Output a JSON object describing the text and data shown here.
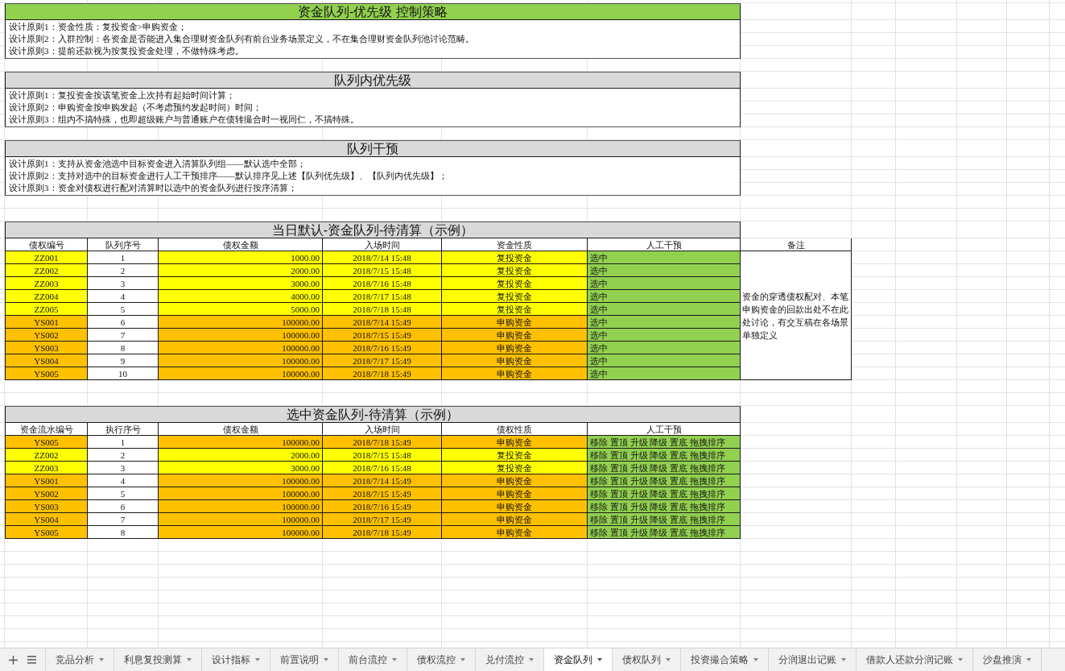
{
  "sheet": {
    "sections": [
      {
        "title": "资金队列-优先级 控制策略",
        "color": "#92d050",
        "lines": [
          "设计原则1：资金性质：复投资金>申购资金；",
          "设计原则2：入群控制：各资金是否能进入集合理财资金队列有前台业务场景定义，不在集合理财资金队列池讨论范畴。",
          "设计原则3：提前还款视为按复投资金处理，不做特殊考虑。"
        ]
      },
      {
        "title": "队列内优先级",
        "color": "#d9d9d9",
        "lines": [
          "设计原则1：复投资金按该笔资金上次持有起始时间计算；",
          "设计原则2：申购资金按申购发起（不考虑预约发起时间）时间；",
          "设计原则3：组内不搞特殊，也即超级账户与普通账户在债转撮合时一视同仁，不搞特殊。"
        ]
      },
      {
        "title": "队列干预",
        "color": "#d9d9d9",
        "lines": [
          "设计原则1：支持从资金池选中目标资金进入清算队列组——默认选中全部；",
          "设计原则2：支持对选中的目标资金进行人工干预排序——默认排序见上述【队列优先级】、【队列内优先级】；",
          "设计原则3：资金对债权进行配对清算时以选中的资金队列进行按序清算；"
        ]
      }
    ],
    "tables": [
      {
        "title": "当日默认-资金队列-待清算（示例）",
        "columns": [
          "债权编号",
          "队列序号",
          "债权金额",
          "入场时间",
          "资金性质",
          "人工干预",
          "备注"
        ],
        "rows": [
          {
            "color": "#ffff00",
            "cells": [
              "ZZ001",
              "1",
              "1000.00",
              "2018/7/14 15:48",
              "复投资金",
              "选中"
            ]
          },
          {
            "color": "#ffff00",
            "cells": [
              "ZZ002",
              "2",
              "2000.00",
              "2018/7/15 15:48",
              "复投资金",
              "选中"
            ]
          },
          {
            "color": "#ffff00",
            "cells": [
              "ZZ003",
              "3",
              "3000.00",
              "2018/7/16 15:48",
              "复投资金",
              "选中"
            ]
          },
          {
            "color": "#ffff00",
            "cells": [
              "ZZ004",
              "4",
              "4000.00",
              "2018/7/17 15:48",
              "复投资金",
              "选中"
            ]
          },
          {
            "color": "#ffff00",
            "cells": [
              "ZZ005",
              "5",
              "5000.00",
              "2018/7/18 15:48",
              "复投资金",
              "选中"
            ]
          },
          {
            "color": "#ffc000",
            "cells": [
              "YS001",
              "6",
              "100000.00",
              "2018/7/14 15:49",
              "申购资金",
              "选中"
            ]
          },
          {
            "color": "#ffc000",
            "cells": [
              "YS002",
              "7",
              "100000.00",
              "2018/7/15 15:49",
              "申购资金",
              "选中"
            ]
          },
          {
            "color": "#ffc000",
            "cells": [
              "YS003",
              "8",
              "100000.00",
              "2018/7/16 15:49",
              "申购资金",
              "选中"
            ]
          },
          {
            "color": "#ffc000",
            "cells": [
              "YS004",
              "9",
              "100000.00",
              "2018/7/17 15:49",
              "申购资金",
              "选中"
            ]
          },
          {
            "color": "#ffc000",
            "cells": [
              "YS005",
              "10",
              "100000.00",
              "2018/7/18 15:49",
              "申购资金",
              "选中"
            ]
          }
        ],
        "remark": "资金的穿透债权配对、本笔申购资金的回款出处不在此处讨论，有交互稿在各场景单独定义"
      },
      {
        "title": "选中资金队列-待清算（示例）",
        "columns": [
          "资金流水编号",
          "执行序号",
          "债权金额",
          "入场时间",
          "债权性质",
          "人工干预"
        ],
        "rows": [
          {
            "color": "#ffc000",
            "cells": [
              "YS005",
              "1",
              "100000.00",
              "2018/7/18 15:49",
              "申购资金",
              "移除 置顶 升级 降级 置底 拖拽排序"
            ]
          },
          {
            "color": "#ffff00",
            "cells": [
              "ZZ002",
              "2",
              "2000.00",
              "2018/7/15 15:48",
              "复投资金",
              "移除 置顶 升级 降级 置底 拖拽排序"
            ]
          },
          {
            "color": "#ffff00",
            "cells": [
              "ZZ003",
              "3",
              "3000.00",
              "2018/7/16 15:48",
              "复投资金",
              "移除 置顶 升级 降级 置底 拖拽排序"
            ]
          },
          {
            "color": "#ffc000",
            "cells": [
              "YS001",
              "4",
              "100000.00",
              "2018/7/14 15:49",
              "申购资金",
              "移除 置顶 升级 降级 置底 拖拽排序"
            ]
          },
          {
            "color": "#ffc000",
            "cells": [
              "YS002",
              "5",
              "100000.00",
              "2018/7/15 15:49",
              "申购资金",
              "移除 置顶 升级 降级 置底 拖拽排序"
            ]
          },
          {
            "color": "#ffc000",
            "cells": [
              "YS003",
              "6",
              "100000.00",
              "2018/7/16 15:49",
              "申购资金",
              "移除 置顶 升级 降级 置底 拖拽排序"
            ]
          },
          {
            "color": "#ffc000",
            "cells": [
              "YS004",
              "7",
              "100000.00",
              "2018/7/17 15:49",
              "申购资金",
              "移除 置顶 升级 降级 置底 拖拽排序"
            ]
          },
          {
            "color": "#ffc000",
            "cells": [
              "YS005",
              "8",
              "100000.00",
              "2018/7/18 15:49",
              "申购资金",
              "移除 置顶 升级 降级 置底 拖拽排序"
            ]
          }
        ]
      }
    ]
  },
  "sheet_tabs": [
    {
      "label": "竞品分析",
      "selected": false
    },
    {
      "label": "利息复投测算",
      "selected": false
    },
    {
      "label": "设计指标",
      "selected": false
    },
    {
      "label": "前置说明",
      "selected": false
    },
    {
      "label": "前台流控",
      "selected": false
    },
    {
      "label": "债权流控",
      "selected": false
    },
    {
      "label": "兑付流控",
      "selected": false
    },
    {
      "label": "资金队列",
      "selected": true
    },
    {
      "label": "债权队列",
      "selected": false
    },
    {
      "label": "投资撮合策略",
      "selected": false
    },
    {
      "label": "分润退出记账",
      "selected": false
    },
    {
      "label": "借款人还款分润记账",
      "selected": false
    },
    {
      "label": "沙盘推演",
      "selected": false
    }
  ]
}
